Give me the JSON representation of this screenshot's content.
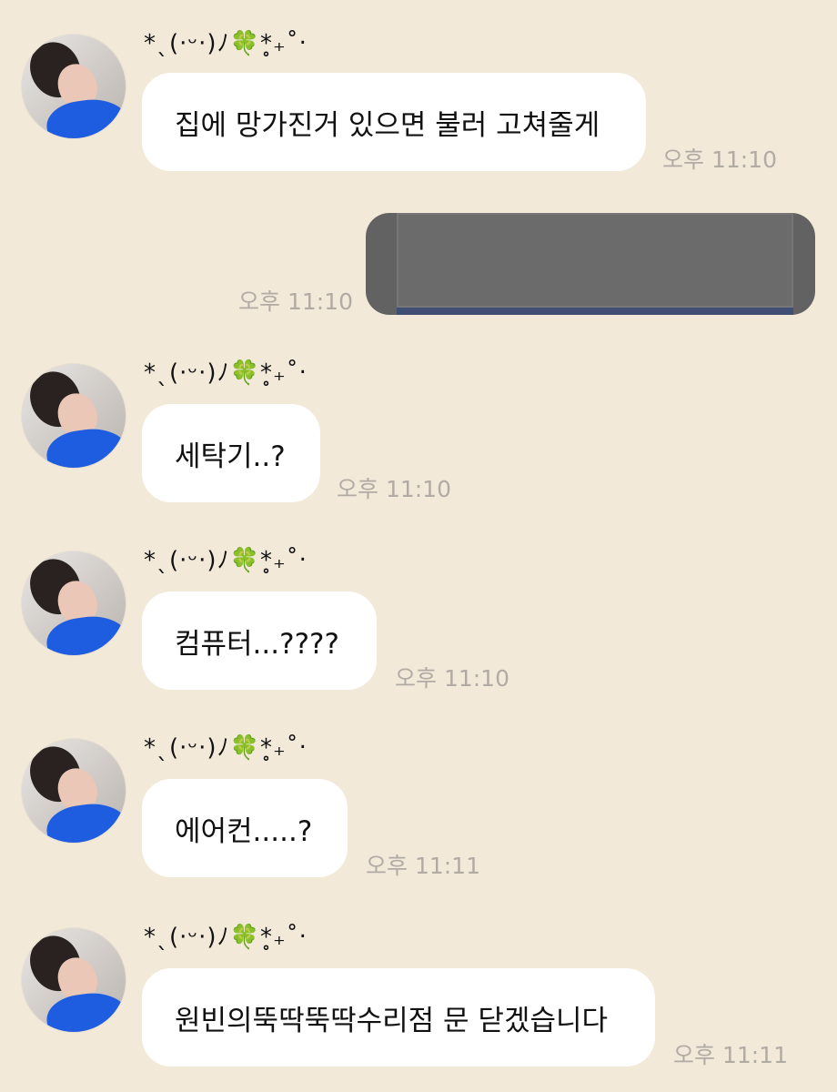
{
  "chat": {
    "messages": [
      {
        "type": "incoming",
        "sender": "*ˎ(·ᵕ·)ﾉ🍀*̥₊˚‧",
        "text": "집에 망가진거 있으면 불러 고쳐줄게",
        "time": "오후 11:10"
      },
      {
        "type": "outgoing",
        "image_desc": "gray appliance photo",
        "time": "오후 11:10"
      },
      {
        "type": "incoming",
        "sender": "*ˎ(·ᵕ·)ﾉ🍀*̥₊˚‧",
        "text": "세탁기..?",
        "time": "오후 11:10"
      },
      {
        "type": "incoming",
        "sender": "*ˎ(·ᵕ·)ﾉ🍀*̥₊˚‧",
        "text": "컴퓨터...????",
        "time": "오후 11:10"
      },
      {
        "type": "incoming",
        "sender": "*ˎ(·ᵕ·)ﾉ🍀*̥₊˚‧",
        "text": "에어컨.....?",
        "time": "오후 11:11"
      },
      {
        "type": "incoming",
        "sender": "*ˎ(·ᵕ·)ﾉ🍀*̥₊˚‧",
        "text": "원빈의뚝딱뚝딱수리점 문 닫겠습니다",
        "time": "오후 11:11"
      }
    ]
  }
}
